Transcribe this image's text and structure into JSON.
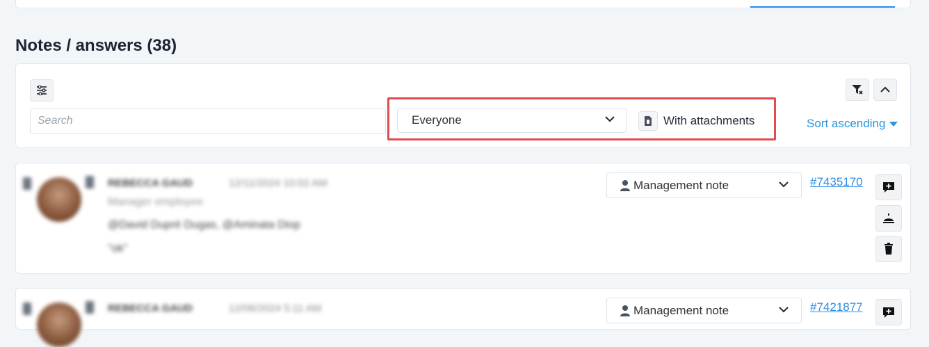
{
  "section": {
    "title": "Notes / answers (38)"
  },
  "filters": {
    "search_placeholder": "Search",
    "author_filter_value": "Everyone",
    "attachments_label": "With attachments",
    "sort_label": "Sort ascending"
  },
  "notes": [
    {
      "author": "REBECCA GAUD",
      "timestamp": "12/11/2024 10:02 AM",
      "role": "Manager employee",
      "mentions": "@David Dupré Dugas, @Aminata Diop",
      "body": "\"ok\"",
      "type": "Management note",
      "id": "#7435170"
    },
    {
      "author": "REBECCA GAUD",
      "timestamp": "12/06/2024 5:11 AM",
      "type": "Management note",
      "id": "#7421877"
    }
  ],
  "colors": {
    "accent": "#2b8ee6",
    "highlight": "#e14b4b",
    "background": "#f3f6f9"
  }
}
